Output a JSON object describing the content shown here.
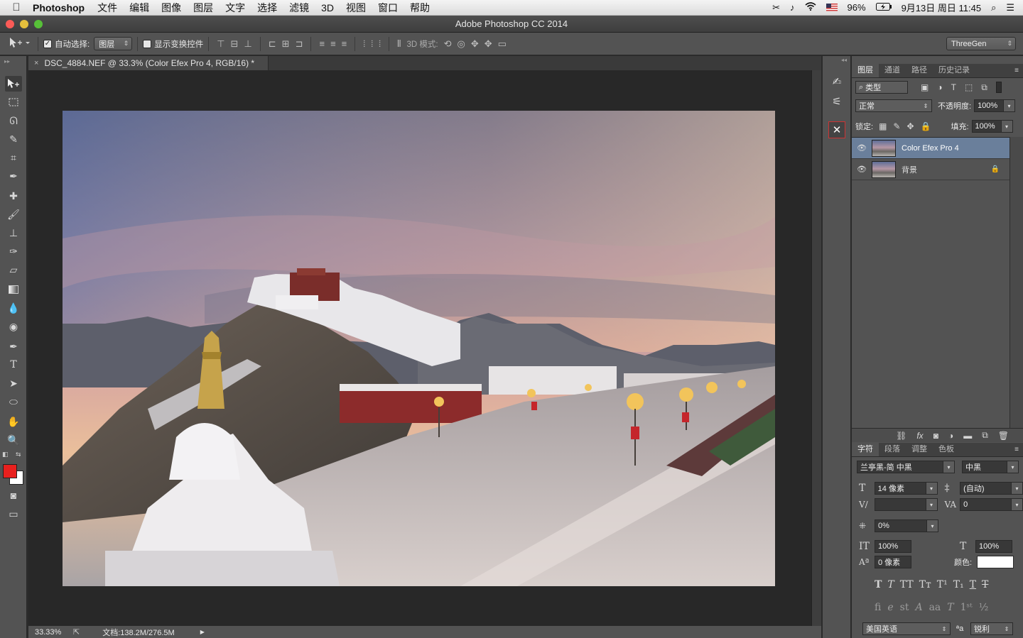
{
  "menubar": {
    "apple": "",
    "app": "Photoshop",
    "menus": [
      "文件",
      "编辑",
      "图像",
      "图层",
      "文字",
      "选择",
      "滤镜",
      "3D",
      "视图",
      "窗口",
      "帮助"
    ],
    "battery": "96%",
    "datetime": "9月13日 周日 11:45"
  },
  "window": {
    "title": "Adobe Photoshop CC 2014",
    "traffic_colors": [
      "#fc5b57",
      "#e5bf3c",
      "#57c038"
    ]
  },
  "options": {
    "auto_select_label": "自动选择:",
    "auto_select_value": "图层",
    "show_transform_label": "显示变换控件",
    "mode3d_label": "3D 模式:",
    "workspace": "ThreeGen"
  },
  "document": {
    "tab_title": "DSC_4884.NEF @ 33.3% (Color Efex Pro 4, RGB/16) *",
    "close": "×",
    "zoom": "33.33%",
    "doc_size": "文档:138.2M/276.5M"
  },
  "colors": {
    "foreground": "#e8201e",
    "background": "#ffffff",
    "selected_layer": "#6a7f9b"
  },
  "layers_panel": {
    "tabs": [
      "图层",
      "通道",
      "路径",
      "历史记录"
    ],
    "filter_kind": "类型",
    "blend_mode": "正常",
    "opacity_label": "不透明度:",
    "opacity": "100%",
    "lock_label": "锁定:",
    "fill_label": "填充:",
    "fill": "100%",
    "layers": [
      {
        "name": "Color Efex Pro 4",
        "selected": true
      },
      {
        "name": "背景",
        "locked": true
      }
    ],
    "footer_fx": "fx"
  },
  "char_panel": {
    "tabs": [
      "字符",
      "段落",
      "调整",
      "色板"
    ],
    "font_family": "兰亭黑-简 中黑",
    "font_style": "中黑",
    "font_size": "14 像素",
    "leading": "(自动)",
    "kerning": "",
    "tracking": "0",
    "tsume": "0%",
    "vscale": "100%",
    "hscale": "100%",
    "baseline": "0 像素",
    "color_label": "颜色:",
    "language": "美国英语",
    "aa_icon": "ªa",
    "antialias": "锐利"
  },
  "icons": {
    "move": "move-tool-icon",
    "hand": "hand-tool-icon",
    "zoom": "zoom-tool-icon",
    "eye": "eye-icon",
    "lock": "lock-icon"
  }
}
